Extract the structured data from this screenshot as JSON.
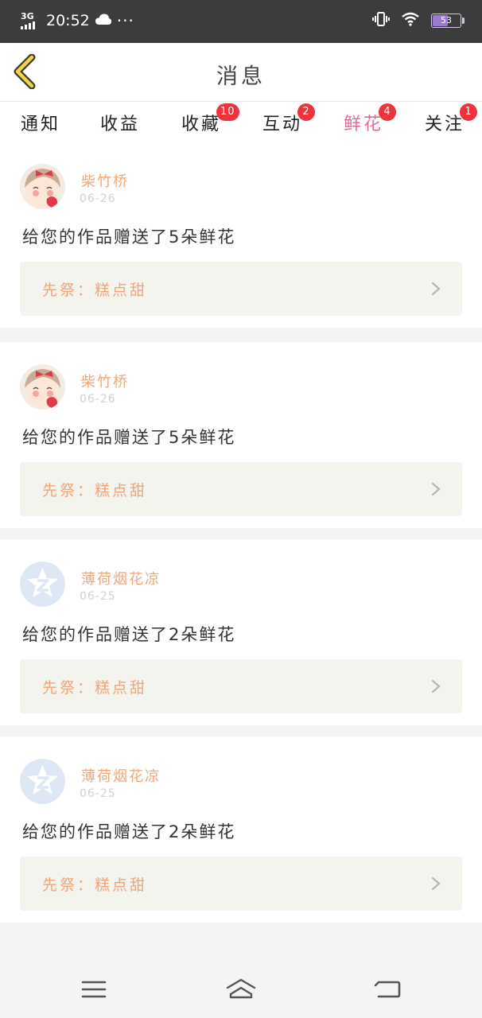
{
  "status_bar": {
    "network": "3G",
    "time": "20:52",
    "dots": "···",
    "battery": "53"
  },
  "header": {
    "title": "消息"
  },
  "tabs": [
    {
      "label": "通知",
      "badge": ""
    },
    {
      "label": "收益",
      "badge": ""
    },
    {
      "label": "收藏",
      "badge": "10"
    },
    {
      "label": "互动",
      "badge": "2"
    },
    {
      "label": "鲜花",
      "badge": "4"
    },
    {
      "label": "关注",
      "badge": "1"
    }
  ],
  "active_tab": "鲜花",
  "messages": [
    {
      "user": "柴竹桥",
      "date": "06-26",
      "text": "给您的作品赠送了5朵鲜花",
      "work": "先祭：糕点甜",
      "avatar": "girl-avatar"
    },
    {
      "user": "柴竹桥",
      "date": "06-26",
      "text": "给您的作品赠送了5朵鲜花",
      "work": "先祭：糕点甜",
      "avatar": "girl-avatar"
    },
    {
      "user": "薄荷烟花凉",
      "date": "06-25",
      "text": "给您的作品赠送了2朵鲜花",
      "work": "先祭：糕点甜",
      "avatar": "qq-default-avatar"
    },
    {
      "user": "薄荷烟花凉",
      "date": "06-25",
      "text": "给您的作品赠送了2朵鲜花",
      "work": "先祭：糕点甜",
      "avatar": "qq-default-avatar"
    }
  ],
  "colors": {
    "accent": "#e06aa0",
    "name": "#f0a57a",
    "badge": "#f0323c"
  }
}
